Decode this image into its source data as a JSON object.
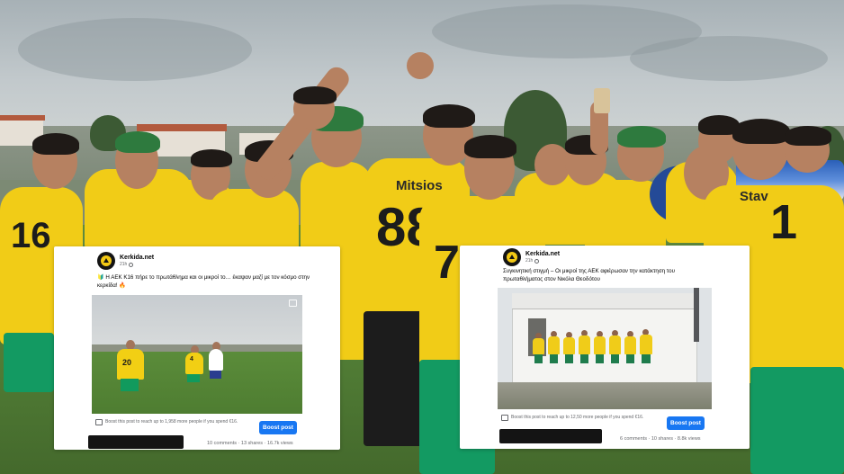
{
  "colors": {
    "jersey_yellow": "#f1cc17",
    "shorts_green": "#139a62",
    "boost_button": "#1877f2"
  },
  "background": {
    "jersey_names": [
      "Mitsios",
      "Stav"
    ],
    "jersey_numbers": [
      "16",
      "88",
      "7",
      "1"
    ]
  },
  "posts": [
    {
      "page_name": "Kerkida.net",
      "time": "21h",
      "text": "🔰 Η ΑΕΚ Κ16 πήρε το πρωτάθλημα και οι μικροί το… έκαψαν μαζί με τον κόσμο στην κερκίδα! 🔥",
      "image_numbers": [
        "20",
        "4"
      ],
      "boost_text": "Boost this post to reach up to 1,958 more people if you spend €16.",
      "boost_button": "Boost post",
      "stats": "10 comments  · 13 shares  · 16.7k views"
    },
    {
      "page_name": "Kerkida.net",
      "time": "21h",
      "text": "Συγκινητική στιγμή – Οι μικροί της ΑΕΚ αφιέρωσαν την κατάκτηση του πρωταθλήματος στον Νικόλα Θεοδότου",
      "boost_text": "Boost this post to reach up to 12,50 more people if you spend €16.",
      "boost_button": "Boost post",
      "stats": "6 comments  · 10 shares  · 8.8k views"
    }
  ],
  "icons": {
    "avatar": "kerkida-logo-icon",
    "privacy": "globe-icon",
    "boost": "boost-chart-icon",
    "image_action": "expand-icon"
  }
}
